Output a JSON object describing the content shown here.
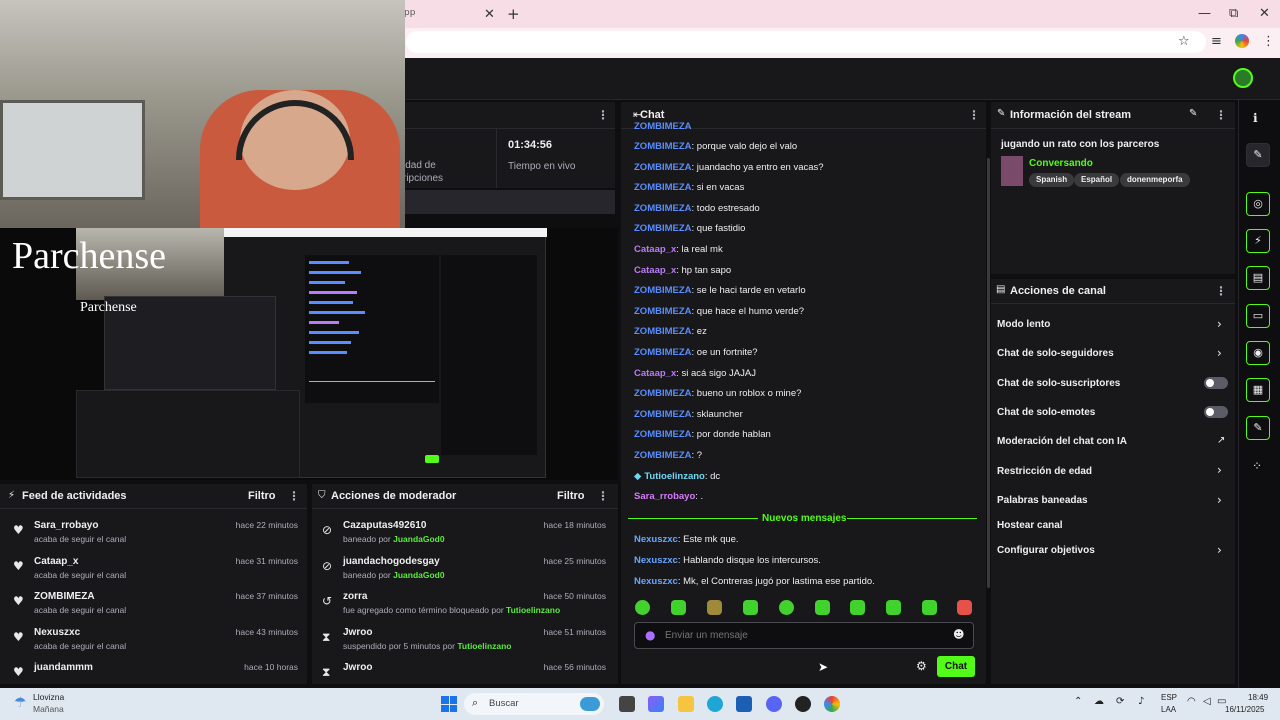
{
  "browser": {
    "tab_fragment": "pp",
    "new_tab": "+",
    "win_min": "—",
    "win_max": "⧉",
    "win_close": "✕"
  },
  "stats": {
    "uptime": "01:34:56",
    "uptime_label": "Tiempo en vivo",
    "subs_label_1": "idad de",
    "subs_label_2": "ripciones"
  },
  "overlay": {
    "brand": "Parchense",
    "brand_small": "Parchense"
  },
  "chat": {
    "title": "Chat",
    "top_partial": "ZOMBIMEZA",
    "messages": [
      {
        "user": "ZOMBIMEZA",
        "cls": "u-zomb",
        "text": ": porque valo dejo el valo"
      },
      {
        "user": "ZOMBIMEZA",
        "cls": "u-zomb",
        "text": ": juandacho ya entro en vacas?"
      },
      {
        "user": "ZOMBIMEZA",
        "cls": "u-zomb",
        "text": ": si en vacas"
      },
      {
        "user": "ZOMBIMEZA",
        "cls": "u-zomb",
        "text": ": todo estresado"
      },
      {
        "user": "ZOMBIMEZA",
        "cls": "u-zomb",
        "text": ": que fastidio"
      },
      {
        "user": "Cataap_x",
        "cls": "u-cata",
        "text": ": la real mk"
      },
      {
        "user": "Cataap_x",
        "cls": "u-cata",
        "text": ": hp tan sapo"
      },
      {
        "user": "ZOMBIMEZA",
        "cls": "u-zomb",
        "text": ": se le haci tarde en vetarlo"
      },
      {
        "user": "ZOMBIMEZA",
        "cls": "u-zomb",
        "text": ": que hace el humo verde?"
      },
      {
        "user": "ZOMBIMEZA",
        "cls": "u-zomb",
        "text": ": ez"
      },
      {
        "user": "ZOMBIMEZA",
        "cls": "u-zomb",
        "text": ": oe un fortnite?"
      },
      {
        "user": "Cataap_x",
        "cls": "u-cata",
        "text": ": si acá sigo JAJAJ"
      },
      {
        "user": "ZOMBIMEZA",
        "cls": "u-zomb",
        "text": ": bueno un roblox o mine?"
      },
      {
        "user": "ZOMBIMEZA",
        "cls": "u-zomb",
        "text": ": sklauncher"
      },
      {
        "user": "ZOMBIMEZA",
        "cls": "u-zomb",
        "text": ": por donde hablan"
      },
      {
        "user": "ZOMBIMEZA",
        "cls": "u-zomb",
        "text": ": ?"
      },
      {
        "user": "Tutioelinzano",
        "cls": "u-tuti",
        "text": ": dc"
      },
      {
        "user": "Sara_rrobayo",
        "cls": "u-sara",
        "text": ": ."
      }
    ],
    "new_messages_label": "Nuevos mensajes",
    "new_messages": [
      {
        "user": "Nexuszxc",
        "cls": "u-nex",
        "text": ": Este mk que."
      },
      {
        "user": "Nexuszxc",
        "cls": "u-nex",
        "text": ": Hablando disque los intercursos."
      },
      {
        "user": "Nexuszxc",
        "cls": "u-nex",
        "text": ": Mk, el Contreras jugó por lastima ese partido."
      }
    ],
    "input_placeholder": "Enviar un mensaje",
    "send_label": "Chat",
    "accent": "#53fc18"
  },
  "stream_info": {
    "header": "Información del stream",
    "title": "jugando un rato con los parceros",
    "category": "Conversando",
    "tags": [
      "Spanish",
      "Español",
      "donenmeporfa"
    ]
  },
  "channel_actions": {
    "header": "Acciones de canal",
    "items": [
      {
        "label": "Modo lento",
        "kind": "chevron"
      },
      {
        "label": "Chat de solo-seguidores",
        "kind": "chevron"
      },
      {
        "label": "Chat de solo-suscriptores",
        "kind": "toggle",
        "on": false
      },
      {
        "label": "Chat de solo-emotes",
        "kind": "toggle",
        "on": false
      },
      {
        "label": "Moderación del chat con IA",
        "kind": "external"
      },
      {
        "label": "Restricción de edad",
        "kind": "chevron"
      },
      {
        "label": "Palabras baneadas",
        "kind": "chevron"
      },
      {
        "label": "Hostear canal",
        "kind": "none"
      },
      {
        "label": "Configurar objetivos",
        "kind": "chevron"
      }
    ]
  },
  "activity_feed": {
    "header": "Feed de actividades",
    "filter": "Filtro",
    "rows": [
      {
        "name": "Sara_rrobayo",
        "sub": "acaba de seguir el canal",
        "time": "hace 22 minutos"
      },
      {
        "name": "Cataap_x",
        "sub": "acaba de seguir el canal",
        "time": "hace 31 minutos"
      },
      {
        "name": "ZOMBIMEZA",
        "sub": "acaba de seguir el canal",
        "time": "hace 37 minutos"
      },
      {
        "name": "Nexuszxc",
        "sub": "acaba de seguir el canal",
        "time": "hace 43 minutos"
      },
      {
        "name": "juandammm",
        "sub": "",
        "time": "hace 10 horas"
      }
    ]
  },
  "mod_actions": {
    "header": "Acciones de moderador",
    "filter": "Filtro",
    "rows": [
      {
        "name": "Cazaputas492610",
        "sub": "baneado por ",
        "by": "JuandaGod0",
        "time": "hace 18 minutos",
        "icon": "⊘"
      },
      {
        "name": "juandachogodesgay",
        "sub": "baneado por ",
        "by": "JuandaGod0",
        "time": "hace 25 minutos",
        "icon": "⊘"
      },
      {
        "name": "zorra",
        "sub": "fue agregado como término bloqueado por ",
        "by": "Tutioelinzano",
        "time": "hace 50 minutos",
        "icon": "↺"
      },
      {
        "name": "Jwroo",
        "sub": "suspendido por 5 minutos por ",
        "by": "Tutioelinzano",
        "time": "hace 51 minutos",
        "icon": "⧗"
      },
      {
        "name": "Jwroo",
        "sub": "",
        "by": "",
        "time": "hace 56 minutos",
        "icon": "⧗"
      }
    ]
  },
  "taskbar": {
    "weather": "Llovizna",
    "weather_sub": "Mañana",
    "search": "Buscar",
    "lang": "ESP",
    "lang_sub": "LAA",
    "time": "18:49",
    "date": "16/11/2025"
  }
}
